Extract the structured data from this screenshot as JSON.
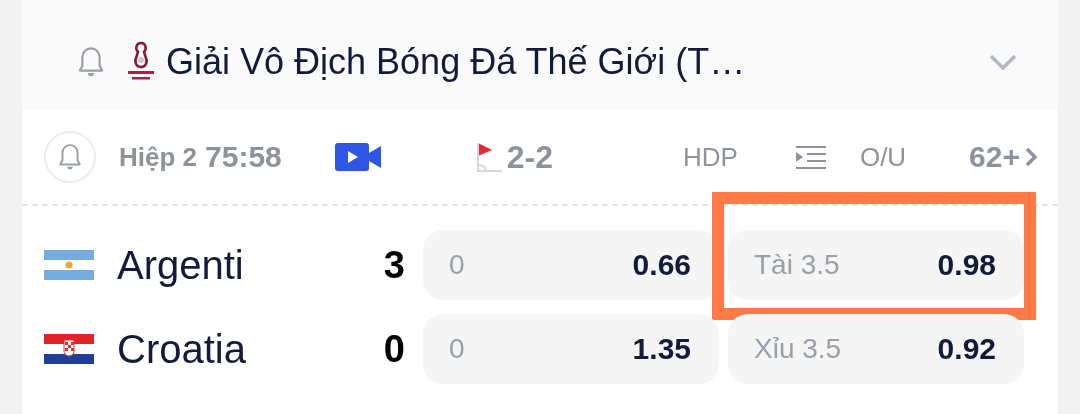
{
  "league": {
    "title": "Giải Vô Địch Bóng Đá Thế Giới (T…",
    "expanded": false
  },
  "match": {
    "period": "Hiệp 2",
    "clock": "75:58",
    "corners": "2-2",
    "hdp_label": "HDP",
    "ou_label": "O/U",
    "more_markets": "62+"
  },
  "teams": [
    {
      "name": "Argenti",
      "score": "3",
      "flag": {
        "kind": "argentina"
      },
      "hdp": {
        "line": "0",
        "odds": "0.66",
        "highlighted": false
      },
      "ou": {
        "line": "Tài 3.5",
        "odds": "0.98",
        "highlighted": true
      }
    },
    {
      "name": "Croatia",
      "score": "0",
      "flag": {
        "kind": "croatia"
      },
      "hdp": {
        "line": "0",
        "odds": "1.35",
        "highlighted": false
      },
      "ou": {
        "line": "Xỉu 3.5",
        "odds": "0.92",
        "highlighted": false
      }
    }
  ]
}
